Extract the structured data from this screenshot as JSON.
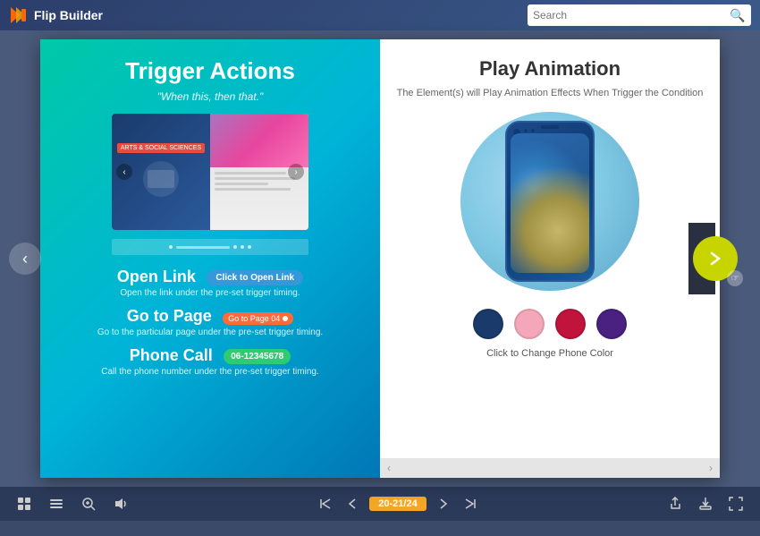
{
  "header": {
    "logo_text": "Flip Builder",
    "search_placeholder": "Search"
  },
  "left_page": {
    "title": "Trigger Actions",
    "subtitle": "\"When this, then that.\"",
    "book_preview": {
      "tag_text": "ARTS & SOCIAL SCIENCES"
    },
    "actions": [
      {
        "id": "open_link",
        "title": "Open Link",
        "button_label": "Click to Open Link",
        "button_type": "blue",
        "description": "Open the link under the pre-set trigger timing."
      },
      {
        "id": "go_to_page",
        "title": "Go to Page",
        "button_label": "Go to Page 04",
        "button_type": "pink",
        "has_dot": true,
        "description": "Go to the particular page under the pre-set trigger timing."
      },
      {
        "id": "phone_call",
        "title": "Phone Call",
        "button_label": "06-12345678",
        "button_type": "green",
        "description": "Call the phone number under the pre-set trigger timing."
      }
    ]
  },
  "right_page": {
    "title": "Play Animation",
    "description": "The Element(s) will Play Animation Effects When Trigger the Condition",
    "phone_colors": [
      {
        "name": "navy",
        "hex": "#1a3a6b"
      },
      {
        "name": "pink",
        "hex": "#f4a7b9"
      },
      {
        "name": "crimson",
        "hex": "#c0143c"
      },
      {
        "name": "purple",
        "hex": "#4a2080"
      }
    ],
    "caption": "Click to Change Phone Color"
  },
  "toolbar": {
    "page_display": "20-21/24",
    "left_icons": [
      "grid-icon",
      "list-icon",
      "zoom-icon",
      "sound-icon"
    ],
    "right_icons": [
      "share-icon",
      "download-icon",
      "fullscreen-icon"
    ],
    "nav_icons": [
      "first-icon",
      "prev-icon",
      "next-icon",
      "last-icon"
    ]
  }
}
